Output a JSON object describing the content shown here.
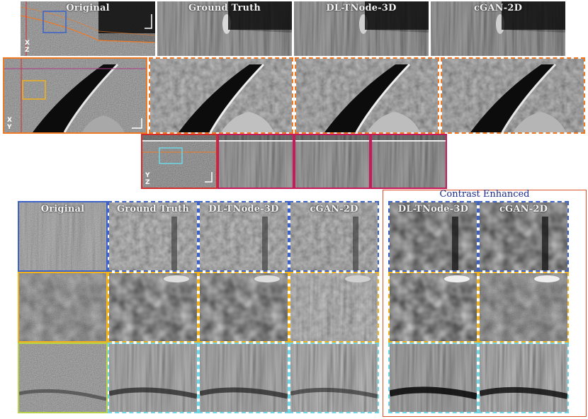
{
  "top_row": {
    "labels": [
      "Original",
      "Ground Truth",
      "DL-TNode-3D",
      "cGAN-2D"
    ]
  },
  "axes": {
    "xz": [
      "X",
      "Z"
    ],
    "xy": [
      "X",
      "Y"
    ],
    "yz": [
      "Y",
      "Z"
    ]
  },
  "zoom_grid": {
    "column_labels": [
      "Original",
      "Ground Truth",
      "DL-TNode-3D",
      "cGAN-2D"
    ],
    "contrast_title": "Contrast Enhanced",
    "contrast_labels": [
      "DL-TNode-3D",
      "cGAN-2D"
    ]
  },
  "colors": {
    "orange": "#f07a24",
    "red": "#d42b2b",
    "crimson": "#c8195a",
    "blue": "#3d62c8",
    "yellow": "#f2b21b",
    "cyan": "#6fd6e6",
    "green_yellow": "#b7d24a",
    "contrast_box": "#e0502a",
    "title_blue": "#1a2a8c"
  }
}
